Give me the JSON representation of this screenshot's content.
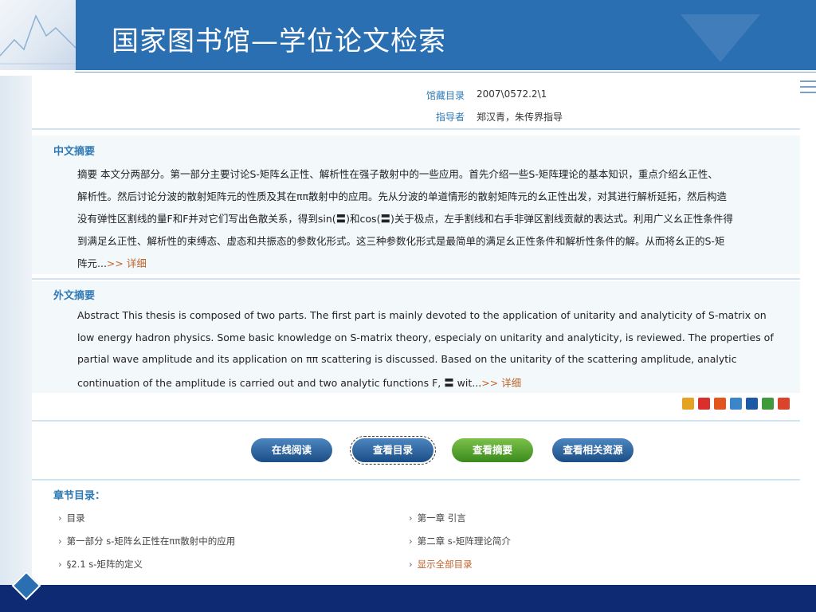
{
  "slide": {
    "title": "国家图书馆—学位论文检索"
  },
  "meta": {
    "call_number_label": "馆藏目录",
    "call_number_value": "2007\\0572.2\\1",
    "advisor_label": "指导者",
    "advisor_value": "郑汉青，朱传界指导"
  },
  "abstract_zh": {
    "title": "中文摘要",
    "lines": [
      "摘要 本文分两部分。第一部分主要讨论S-矩阵幺正性、解析性在强子散射中的一些应用。首先介绍一些S-矩阵理论的基本知识，重点介绍幺正性、",
      "解析性。然后讨论分波的散射矩阵元的性质及其在ππ散射中的应用。先从分波的单道情形的散射矩阵元的幺正性出发，对其进行解析延拓，然后构造",
      "没有弹性区割线的量F和F并对它们写出色散关系，得到sin(〓)和cos(〓)关于极点，左手割线和右手非弹区割线贡献的表达式。利用广义幺正性条件得",
      "到满足幺正性、解析性的束缚态、虚态和共振态的参数化形式。这三种参数化形式是最简单的满足幺正性条件和解析性条件的解。从而将幺正的S-矩",
      "阵元..."
    ],
    "more": ">> 详细"
  },
  "abstract_en": {
    "title": "外文摘要",
    "lines": [
      "Abstract This thesis is composed of two parts. The first part is mainly devoted to the application of unitarity and analyticity of S-matrix on",
      "low energy hadron physics. Some basic knowledge on S-matrix theory, especialy on unitarity and analyticity, is reviewed. The properties of",
      "partial wave amplitude and its application on ππ scattering is discussed. Based on the unitarity of the scattering amplitude, analytic",
      "continuation of the amplitude is carried out and two analytic functions F, 〓 wit..."
    ],
    "more": ">> 详细"
  },
  "buttons": {
    "read_online": "在线阅读",
    "view_toc": "查看目录",
    "view_abstract": "查看摘要",
    "view_related": "查看相关资源"
  },
  "toc": {
    "title": "章节目录：",
    "left": [
      "目录",
      "第一部分  s-矩阵幺正性在ππ散射中的应用",
      "§2.1  s-矩阵的定义"
    ],
    "right": [
      "第一章  引言",
      "第二章  s-矩阵理论简介"
    ],
    "show_all": "显示全部目录"
  },
  "share_icons": [
    "qzone-icon",
    "weibo-icon",
    "tieba-icon",
    "kaixin-icon",
    "renren-icon",
    "douban-icon",
    "more-icon"
  ],
  "colors": {
    "header_blue": "#2b6fb3",
    "footer_navy": "#0e2a72",
    "label_blue": "#2f7ab5",
    "link_orange": "#c0622a",
    "button_blue": "#1b4d86",
    "button_green": "#3a8a1c"
  }
}
